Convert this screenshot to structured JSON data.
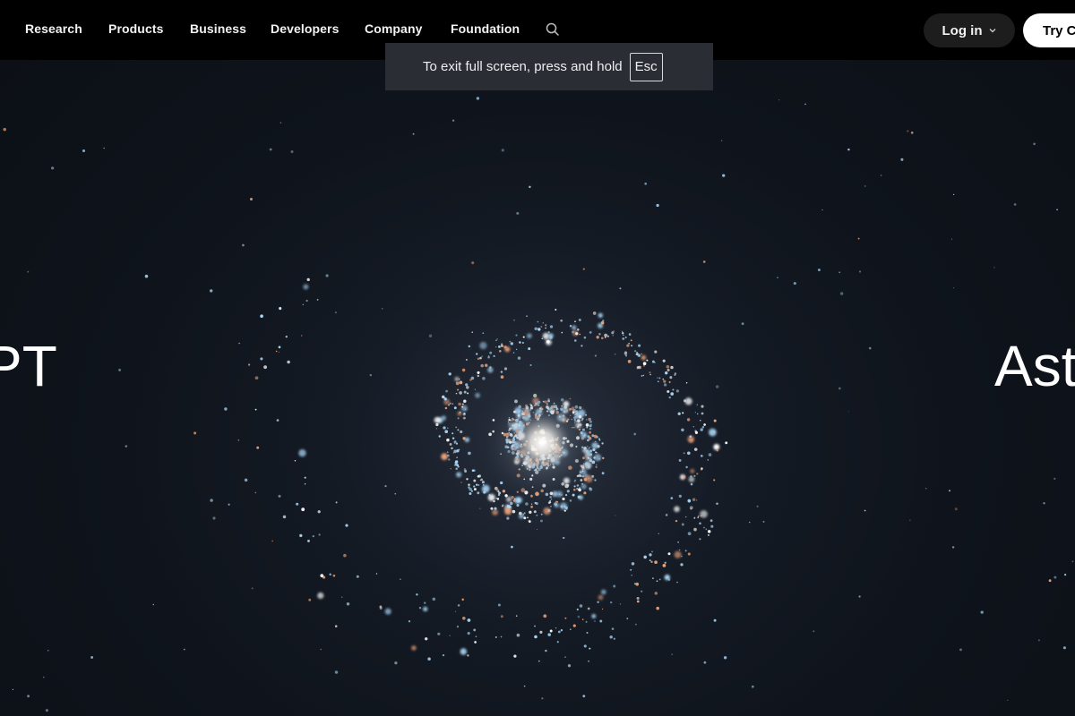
{
  "nav": {
    "items": [
      {
        "label": "Research"
      },
      {
        "label": "Products"
      },
      {
        "label": "Business"
      },
      {
        "label": "Developers"
      },
      {
        "label": "Company"
      },
      {
        "label": "Foundation"
      }
    ],
    "search_icon": "search-icon",
    "login_label": "Log in",
    "login_icon": "chevron-down-icon",
    "try_label": "Try ChatGPT"
  },
  "fullscreen_toast": {
    "message": "To exit full screen, press and hold",
    "key": "Esc"
  },
  "hero": {
    "left_text": "PT",
    "right_text": "Ast"
  },
  "colors": {
    "background": "#0f141c",
    "nav_bg": "#000000",
    "star_blue": "#a9d6f5",
    "star_orange": "#f0a47a",
    "star_white": "#ffffff"
  }
}
